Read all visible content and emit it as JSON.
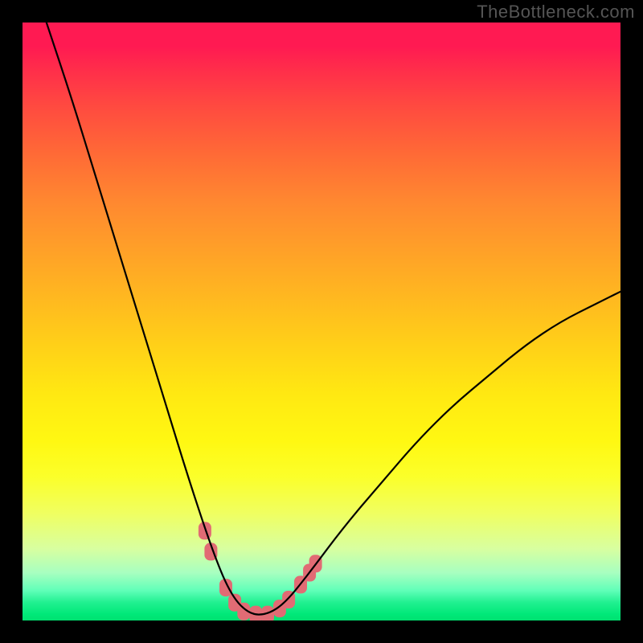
{
  "watermark": "TheBottleneck.com",
  "chart_data": {
    "type": "line",
    "title": "",
    "xlabel": "",
    "ylabel": "",
    "xlim": [
      0,
      100
    ],
    "ylim": [
      0,
      100
    ],
    "grid": false,
    "legend": false,
    "description": "V-shaped bottleneck curve over rainbow vertical gradient (red at top = high bottleneck, green at bottom = none).",
    "gradient_stops": [
      {
        "pos": 0.0,
        "color": "#ff1a52"
      },
      {
        "pos": 0.3,
        "color": "#ff8830"
      },
      {
        "pos": 0.6,
        "color": "#ffe812"
      },
      {
        "pos": 0.85,
        "color": "#d8ffa0"
      },
      {
        "pos": 1.0,
        "color": "#00e070"
      }
    ],
    "curve": {
      "note": "y estimated visually; x maps left→right 0–100; y=100 top, y=0 bottom. Curve starts top-left, dips to ~0 at x≈38, rises to ~55 at x=100.",
      "points": [
        {
          "x": 4.0,
          "y": 100.0
        },
        {
          "x": 8.0,
          "y": 88.0
        },
        {
          "x": 12.0,
          "y": 75.0
        },
        {
          "x": 16.0,
          "y": 62.0
        },
        {
          "x": 20.0,
          "y": 49.0
        },
        {
          "x": 24.0,
          "y": 36.0
        },
        {
          "x": 28.0,
          "y": 23.0
        },
        {
          "x": 32.0,
          "y": 11.0
        },
        {
          "x": 35.0,
          "y": 4.0
        },
        {
          "x": 38.0,
          "y": 1.0
        },
        {
          "x": 41.0,
          "y": 1.0
        },
        {
          "x": 44.0,
          "y": 3.0
        },
        {
          "x": 48.0,
          "y": 8.0
        },
        {
          "x": 54.0,
          "y": 16.0
        },
        {
          "x": 60.0,
          "y": 23.0
        },
        {
          "x": 66.0,
          "y": 30.0
        },
        {
          "x": 72.0,
          "y": 36.0
        },
        {
          "x": 78.0,
          "y": 41.0
        },
        {
          "x": 84.0,
          "y": 46.0
        },
        {
          "x": 90.0,
          "y": 50.0
        },
        {
          "x": 96.0,
          "y": 53.0
        },
        {
          "x": 100.0,
          "y": 55.0
        }
      ]
    },
    "markers": {
      "note": "Rounded pink segments highlight region around the trough.",
      "color": "#e16b74",
      "points": [
        {
          "x": 30.5,
          "y": 15.0
        },
        {
          "x": 31.5,
          "y": 11.5
        },
        {
          "x": 34.0,
          "y": 5.5
        },
        {
          "x": 35.5,
          "y": 3.0
        },
        {
          "x": 37.0,
          "y": 1.5
        },
        {
          "x": 39.0,
          "y": 1.0
        },
        {
          "x": 41.0,
          "y": 1.0
        },
        {
          "x": 43.0,
          "y": 2.0
        },
        {
          "x": 44.5,
          "y": 3.5
        },
        {
          "x": 46.5,
          "y": 6.0
        },
        {
          "x": 48.0,
          "y": 8.0
        },
        {
          "x": 49.0,
          "y": 9.5
        }
      ]
    }
  }
}
